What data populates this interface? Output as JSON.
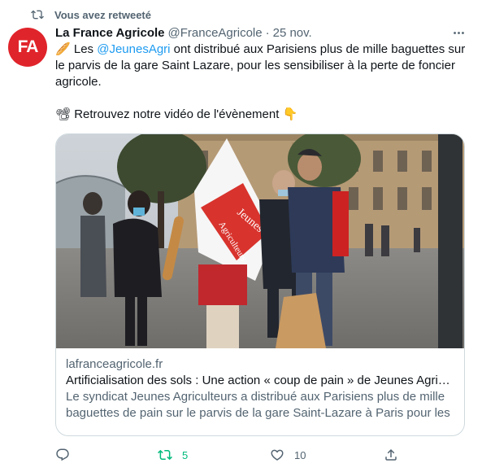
{
  "retweet_banner": {
    "text": "Vous avez retweeté",
    "icon": "retweet-icon"
  },
  "author": {
    "avatar_text": "FA",
    "avatar_color": "#e0242b",
    "name": "La France Agricole",
    "handle": "@FranceAgricole",
    "separator": "·",
    "date": "25 nov."
  },
  "tweet": {
    "line1_emoji": "🥖",
    "line1_pre": " Les ",
    "mention": "@JeunesAgri",
    "line1_post": " ont distribué aux Parisiens plus de mille baguettes sur le parvis de la gare Saint Lazare, pour les sensibiliser à la perte de foncier agricole.",
    "line2": "📽 Retrouvez notre vidéo de l'évènement 👇"
  },
  "card": {
    "image_flag_text_1": "Jeunes",
    "image_flag_text_2": "Agriculteurs",
    "domain": "lafranceagricole.fr",
    "title": "Artificialisation des sols : Une action « coup de pain » de Jeunes Agriculteurs",
    "description": "Le syndicat Jeunes Agriculteurs a distribué aux Parisiens plus de mille baguettes de pain sur le parvis de la gare Saint-Lazare à Paris pour les …"
  },
  "actions": {
    "reply_count": "",
    "retweet_count": "5",
    "like_count": "10",
    "retweet_active_color": "#00ba7c"
  },
  "colors": {
    "accent": "#1d9bf0",
    "muted": "#536471",
    "border": "#cfd9de"
  }
}
